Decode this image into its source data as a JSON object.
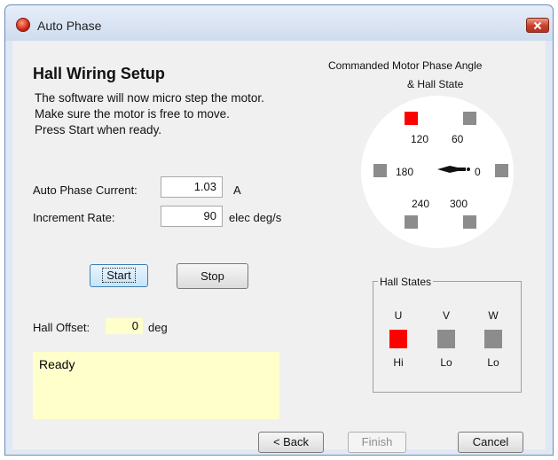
{
  "window": {
    "title": "Auto Phase"
  },
  "heading": "Hall Wiring Setup",
  "instructions": [
    "The software will now micro step the motor.",
    "Make sure the motor is free to move.",
    "Press Start when ready."
  ],
  "current": {
    "label": "Auto Phase Current:",
    "value": "1.03",
    "unit": "A"
  },
  "rate": {
    "label": "Increment Rate:",
    "value": "90",
    "unit": "elec deg/s"
  },
  "buttons": {
    "start": "Start",
    "stop": "Stop",
    "back": "< Back",
    "finish": "Finish",
    "cancel": "Cancel"
  },
  "offset": {
    "label": "Hall Offset:",
    "value": "0",
    "unit": "deg"
  },
  "status": "Ready",
  "diagram": {
    "title": "Commanded Motor Phase Angle",
    "subtitle": "& Hall State",
    "angles": [
      "120",
      "60",
      "180",
      "0",
      "240",
      "300"
    ],
    "active_angle": "120",
    "active_color": "#ff0000",
    "inactive_color": "#8c8c8c"
  },
  "hall": {
    "title": "Hall States",
    "columns": [
      {
        "name": "U",
        "state": "Hi",
        "active": true
      },
      {
        "name": "V",
        "state": "Lo",
        "active": false
      },
      {
        "name": "W",
        "state": "Lo",
        "active": false
      }
    ]
  }
}
